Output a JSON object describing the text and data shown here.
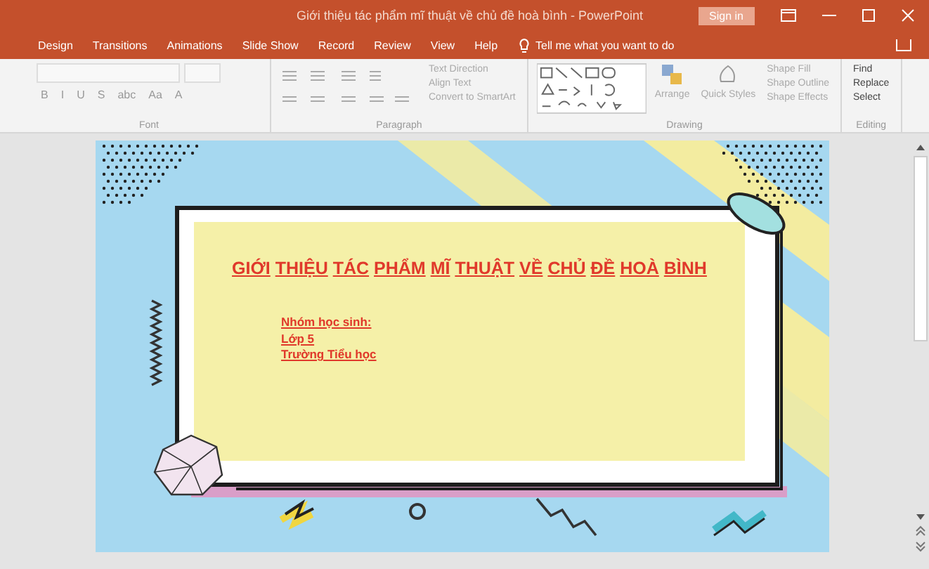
{
  "window": {
    "title": "Giới thiệu tác phẩm mĩ thuật về chủ đề hoà bình - PowerPoint",
    "sign_in": "Sign in"
  },
  "tabs": [
    {
      "label": "Design",
      "selected": false
    },
    {
      "label": "Transitions",
      "selected": false
    },
    {
      "label": "Animations",
      "selected": false
    },
    {
      "label": "Slide Show",
      "selected": false
    },
    {
      "label": "Record",
      "selected": false
    },
    {
      "label": "Review",
      "selected": false
    },
    {
      "label": "View",
      "selected": false
    },
    {
      "label": "Help",
      "selected": false
    }
  ],
  "tell_me": {
    "placeholder": "Tell me what you want to do"
  },
  "ribbon": {
    "groups": [
      {
        "label": "Font",
        "kind": "font",
        "items": [
          "B",
          "I",
          "U",
          "S",
          "abc",
          "Aa",
          "A"
        ]
      },
      {
        "label": "Paragraph",
        "kind": "paragraph",
        "items": [
          "Text Direction",
          "Align Text",
          "Convert to SmartArt"
        ]
      },
      {
        "label": "Drawing",
        "kind": "drawing",
        "items": [
          "Arrange",
          "Quick Styles",
          "Shape Fill",
          "Shape Outline",
          "Shape Effects"
        ]
      },
      {
        "label": "Editing",
        "kind": "editing",
        "items": [
          "Find",
          "Replace",
          "Select"
        ]
      }
    ]
  },
  "slide": {
    "title_parts": [
      "GIỚI",
      "THIỆU",
      "TÁC",
      "PHẨM",
      "MĨ",
      "THUẬT",
      "VỀ",
      "CHỦ",
      "ĐỀ",
      "HOÀ",
      "BÌNH"
    ],
    "lines": [
      "Nhóm học sinh:",
      "Lớp 5",
      "Trường Tiểu học"
    ]
  }
}
